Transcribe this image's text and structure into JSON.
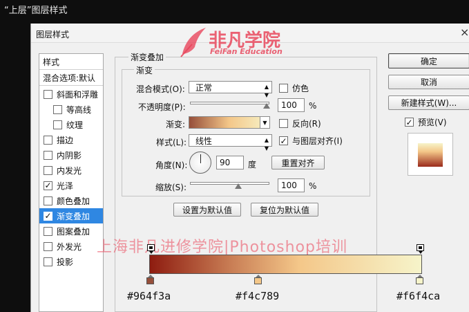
{
  "outer_title": "“上层”图层样式",
  "dialog": {
    "title": "图层样式",
    "close": "×"
  },
  "sidebar": {
    "header": "样式",
    "blend_options": "混合选项:默认",
    "items": [
      {
        "label": "斜面和浮雕",
        "checked": false
      },
      {
        "label": "等高线",
        "checked": false
      },
      {
        "label": "纹理",
        "checked": false
      },
      {
        "label": "描边",
        "checked": false
      },
      {
        "label": "内阴影",
        "checked": false
      },
      {
        "label": "内发光",
        "checked": false
      },
      {
        "label": "光泽",
        "checked": true
      },
      {
        "label": "颜色叠加",
        "checked": false
      },
      {
        "label": "渐变叠加",
        "checked": true
      },
      {
        "label": "图案叠加",
        "checked": false
      },
      {
        "label": "外发光",
        "checked": false
      },
      {
        "label": "投影",
        "checked": false
      }
    ]
  },
  "gradient_overlay": {
    "section_title": "渐变叠加",
    "group_title": "渐变",
    "blend_mode_label": "混合模式(O):",
    "blend_mode_value": "正常",
    "dither_label": "仿色",
    "opacity_label": "不透明度(P):",
    "opacity_value": "100",
    "opacity_unit": "%",
    "opacity_level": 100,
    "gradient_label": "渐变:",
    "reverse_label": "反向(R)",
    "style_label": "样式(L):",
    "style_value": "线性",
    "align_label": "与图层对齐(I)",
    "align_checked": true,
    "angle_label": "角度(N):",
    "angle_value": "90",
    "angle_unit": "度",
    "reset_align_button": "重置对齐",
    "scale_label": "缩放(S):",
    "scale_value": "100",
    "scale_unit": "%",
    "scale_level": 100,
    "set_default_button": "设置为默认值",
    "reset_default_button": "复位为默认值"
  },
  "right_buttons": {
    "ok": "确定",
    "cancel": "取消",
    "new_style": "新建样式(W)...",
    "preview_label": "预览(V)",
    "preview_checked": true
  },
  "watermark": {
    "logo_cn": "非凡学院",
    "logo_en": "FeiFan Education",
    "text": "上海非凡进修学院|Photoshop培训"
  },
  "gradient_stops": [
    {
      "hex": "#964f3a",
      "color": "#964f3a"
    },
    {
      "hex": "#f4c789",
      "color": "#f4c789"
    },
    {
      "hex": "#f6f4ca",
      "color": "#f6f4ca"
    }
  ],
  "colors": {
    "selected_row": "#2f87e2",
    "watermark": "#e8465c"
  }
}
